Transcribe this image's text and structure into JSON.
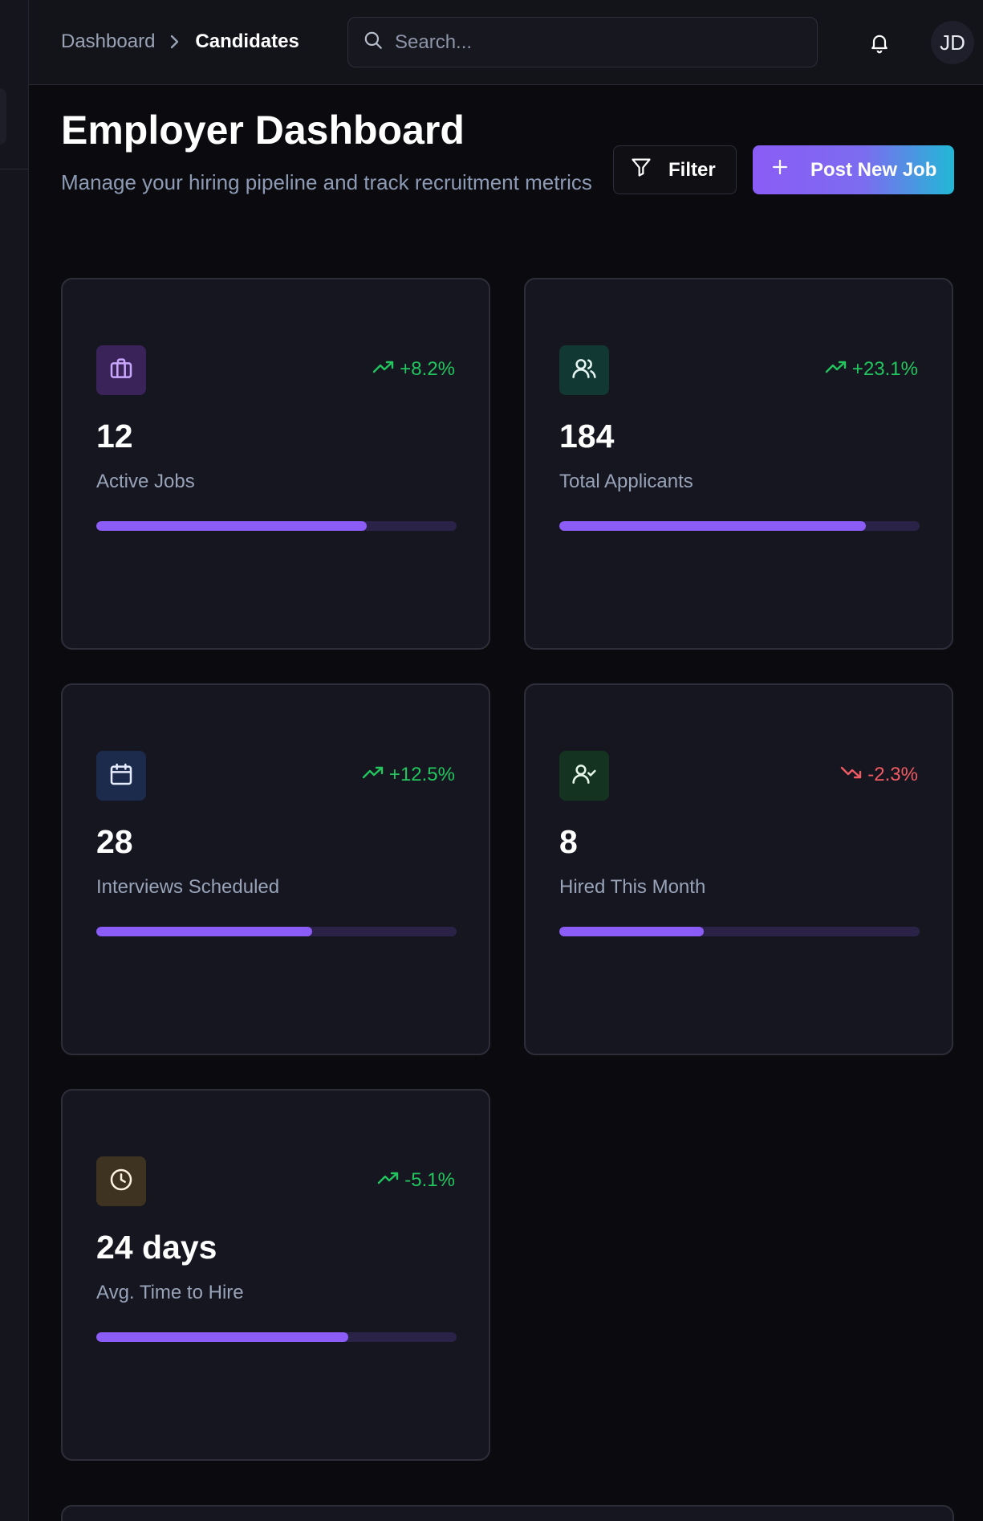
{
  "breadcrumb": {
    "parent": "Dashboard",
    "current": "Candidates"
  },
  "search": {
    "placeholder": "Search..."
  },
  "user": {
    "initials": "JD"
  },
  "page": {
    "title": "Employer Dashboard",
    "subtitle": "Manage your hiring pipeline and track recruitment metrics"
  },
  "actions": {
    "filter_label": "Filter",
    "post_label": "Post New Job"
  },
  "stats": [
    {
      "icon": "briefcase-icon",
      "icon_bg": "#3a2358",
      "icon_color": "#c9a7ff",
      "trend": "+8.2%",
      "trend_dir": "up",
      "value": "12",
      "label": "Active Jobs",
      "progress": 0.75
    },
    {
      "icon": "users-icon",
      "icon_bg": "#123833",
      "icon_color": "#e6f7f3",
      "trend": "+23.1%",
      "trend_dir": "up",
      "value": "184",
      "label": "Total Applicants",
      "progress": 0.85
    },
    {
      "icon": "calendar-icon",
      "icon_bg": "#1c2a4c",
      "icon_color": "#e6ecff",
      "trend": "+12.5%",
      "trend_dir": "up",
      "value": "28",
      "label": "Interviews Scheduled",
      "progress": 0.6
    },
    {
      "icon": "user-check-icon",
      "icon_bg": "#143421",
      "icon_color": "#e6f7ea",
      "trend": "-2.3%",
      "trend_dir": "down",
      "value": "8",
      "label": "Hired This Month",
      "progress": 0.4
    },
    {
      "icon": "clock-icon",
      "icon_bg": "#3e3220",
      "icon_color": "#fff3df",
      "trend": "-5.1%",
      "trend_dir": "up",
      "value": "24 days",
      "label": "Avg. Time to Hire",
      "progress": 0.7
    }
  ]
}
